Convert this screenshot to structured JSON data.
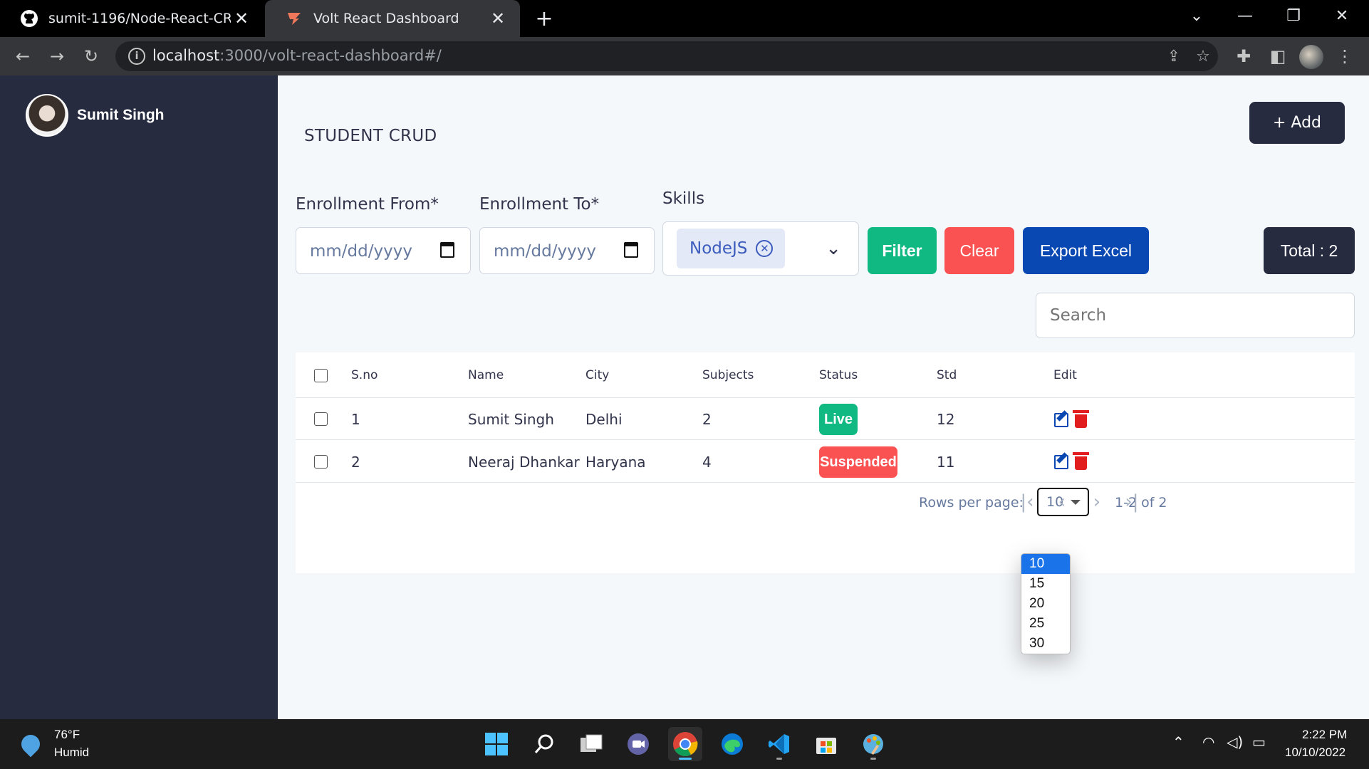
{
  "browser": {
    "tabs": [
      {
        "title": "sumit-1196/Node-React-CRUD",
        "icon": "github-icon"
      },
      {
        "title": "Volt React Dashboard",
        "icon": "volt-icon",
        "active": true
      }
    ],
    "url_host": "localhost",
    "url_rest": ":3000/volt-react-dashboard#/"
  },
  "sidebar": {
    "user_name": "Sumit Singh"
  },
  "main": {
    "title": "STUDENT CRUD",
    "add_label": "+ Add",
    "filters": {
      "enrollment_from_label": "Enrollment From*",
      "enrollment_from_placeholder": "mm/dd/yyyy",
      "enrollment_to_label": "Enrollment To*",
      "enrollment_to_placeholder": "mm/dd/yyyy",
      "skills_label": "Skills",
      "selected_skill": "NodeJS"
    },
    "buttons": {
      "filter": "Filter",
      "clear": "Clear",
      "export": "Export Excel",
      "total": "Total : 2"
    },
    "search_placeholder": "Search",
    "table": {
      "columns": [
        "S.no",
        "Name",
        "City",
        "Subjects",
        "Status",
        "Std",
        "Edit"
      ],
      "rows": [
        {
          "sno": "1",
          "name": "Sumit Singh",
          "city": "Delhi",
          "subjects": "2",
          "status": "Live",
          "std": "12"
        },
        {
          "sno": "2",
          "name": "Neeraj Dhankar",
          "city": "Haryana",
          "subjects": "4",
          "status": "Suspended",
          "std": "11"
        }
      ]
    },
    "pagination": {
      "rows_per_page_label": "Rows per page:",
      "rows_per_page_value": "10",
      "range": "1-2 of 2",
      "options": [
        "10",
        "15",
        "20",
        "25",
        "30"
      ]
    }
  },
  "colors": {
    "sidebar": "#262b40",
    "live": "#10b981",
    "suspended": "#fa5252",
    "export": "#0948b3"
  },
  "taskbar": {
    "weather_temp": "76°F",
    "weather_desc": "Humid",
    "time": "2:22 PM",
    "date": "10/10/2022"
  }
}
